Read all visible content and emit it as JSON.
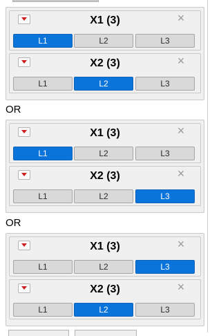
{
  "blocks": [
    {
      "panels": [
        {
          "title": "X1 (3)",
          "levels": [
            "L1",
            "L2",
            "L3"
          ],
          "selected": 0
        },
        {
          "title": "X2 (3)",
          "levels": [
            "L1",
            "L2",
            "L3"
          ],
          "selected": 1
        }
      ]
    },
    {
      "panels": [
        {
          "title": "X1 (3)",
          "levels": [
            "L1",
            "L2",
            "L3"
          ],
          "selected": 0
        },
        {
          "title": "X2 (3)",
          "levels": [
            "L1",
            "L2",
            "L3"
          ],
          "selected": 2
        }
      ]
    },
    {
      "panels": [
        {
          "title": "X1 (3)",
          "levels": [
            "L1",
            "L2",
            "L3"
          ],
          "selected": 2
        },
        {
          "title": "X2 (3)",
          "levels": [
            "L1",
            "L2",
            "L3"
          ],
          "selected": 1
        }
      ]
    }
  ],
  "separators": [
    "OR",
    "OR"
  ],
  "icons": {
    "menu": "red-triangle-menu-icon",
    "close": "close-x-icon"
  },
  "colors": {
    "selected": "#0b74da",
    "panel_bg": "#f0f0f0"
  }
}
